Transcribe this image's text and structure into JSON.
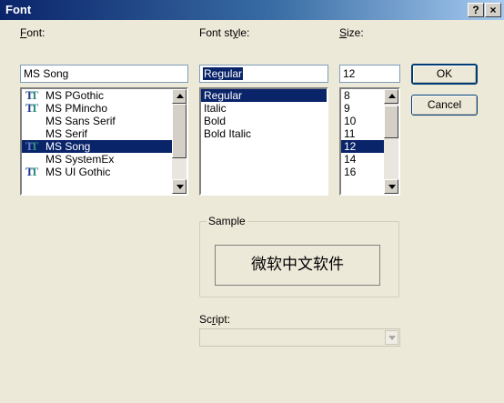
{
  "window": {
    "title": "Font",
    "help_button": "?",
    "close_button": "×"
  },
  "font": {
    "label_prefix": "",
    "label_accel": "F",
    "label_rest": "ont:",
    "value": "MS Song",
    "items": [
      {
        "label": "MS PGothic",
        "truetype": true
      },
      {
        "label": "MS PMincho",
        "truetype": true
      },
      {
        "label": "MS Sans Serif",
        "truetype": false
      },
      {
        "label": "MS Serif",
        "truetype": false
      },
      {
        "label": "MS Song",
        "truetype": true,
        "selected": true
      },
      {
        "label": "MS SystemEx",
        "truetype": false
      },
      {
        "label": "MS UI Gothic",
        "truetype": true
      }
    ]
  },
  "font_style": {
    "label_prefix": "Font st",
    "label_accel": "y",
    "label_rest": "le:",
    "value": "Regular",
    "items": [
      {
        "label": "Regular",
        "selected": true
      },
      {
        "label": "Italic"
      },
      {
        "label": "Bold"
      },
      {
        "label": "Bold Italic"
      }
    ]
  },
  "size": {
    "label_prefix": "",
    "label_accel": "S",
    "label_rest": "ize:",
    "value": "12",
    "items": [
      {
        "label": "8"
      },
      {
        "label": "9"
      },
      {
        "label": "10"
      },
      {
        "label": "11"
      },
      {
        "label": "12",
        "selected": true
      },
      {
        "label": "14"
      },
      {
        "label": "16"
      }
    ]
  },
  "buttons": {
    "ok": "OK",
    "cancel": "Cancel"
  },
  "sample": {
    "label": "Sample",
    "text": "微软中文软件"
  },
  "script": {
    "label_prefix": "Sc",
    "label_accel": "r",
    "label_rest": "ipt:",
    "value": ""
  },
  "icons": {
    "truetype": "truetype-icon",
    "scroll_up": "arrow-up-icon",
    "scroll_down": "arrow-down-icon"
  },
  "colors": {
    "selection": "#0a246a",
    "dialog_bg": "#ece9d8"
  }
}
